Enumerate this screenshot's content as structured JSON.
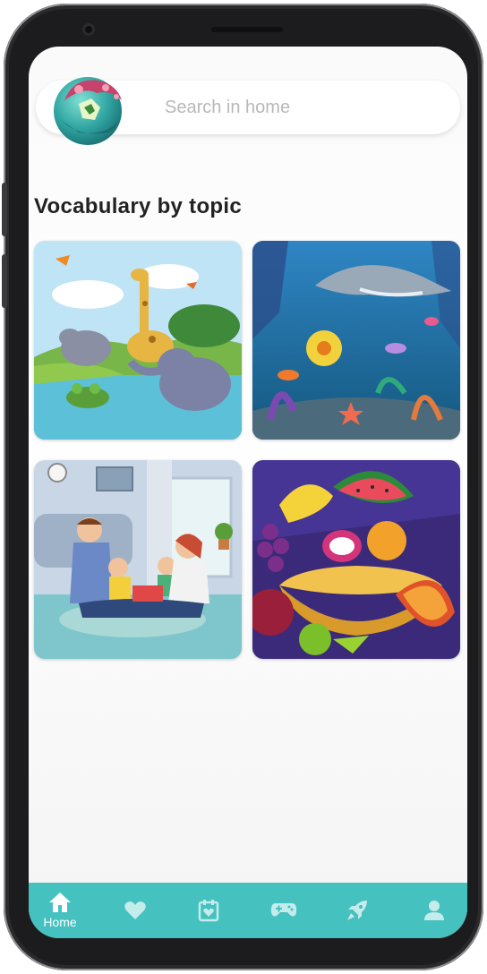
{
  "search": {
    "placeholder": "Search in home"
  },
  "section": {
    "title": "Vocabulary by topic"
  },
  "topics": [
    {
      "icon": "animals-illustration"
    },
    {
      "icon": "ocean-illustration"
    },
    {
      "icon": "family-illustration"
    },
    {
      "icon": "fruits-illustration"
    }
  ],
  "nav": {
    "accent": "#45c1bf",
    "items": [
      {
        "icon": "home-icon",
        "label": "Home"
      },
      {
        "icon": "heart-icon"
      },
      {
        "icon": "calendar-icon"
      },
      {
        "icon": "gamepad-icon"
      },
      {
        "icon": "rocket-icon"
      },
      {
        "icon": "profile-icon"
      }
    ]
  }
}
